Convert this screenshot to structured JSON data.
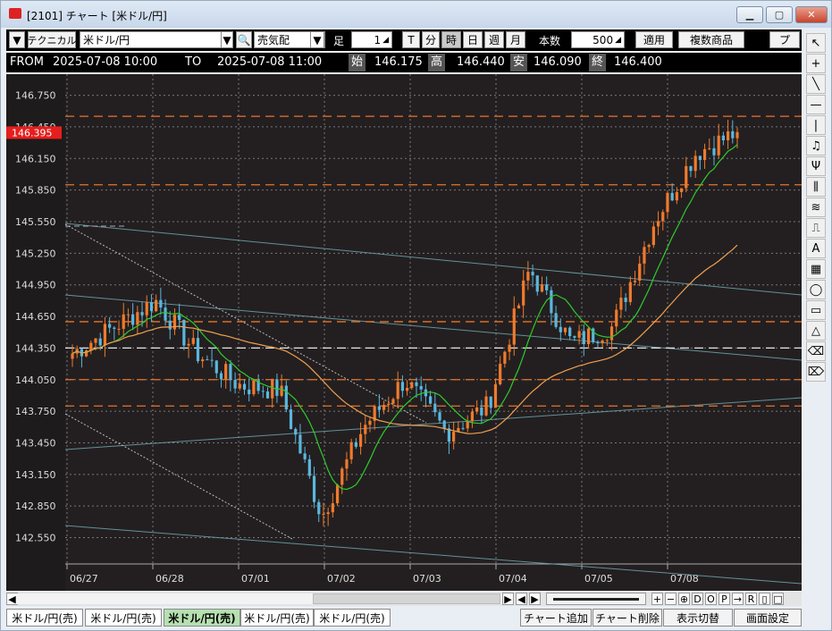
{
  "window": {
    "title": "[2101] チャート [米ドル/円]",
    "minimize_icon": "minimize-icon",
    "maximize_icon": "maximize-icon",
    "close_icon": "close-icon"
  },
  "toolbar": {
    "mode": "テクニカル",
    "symbol": "米ドル/円",
    "side": "売気配",
    "ashi_label": "足",
    "ashi_value": "1",
    "periods": [
      "T",
      "分",
      "時",
      "日",
      "週",
      "月"
    ],
    "active_period": "時",
    "count_label": "本数",
    "count_value": "500",
    "apply_label": "適用",
    "multi_label": "複数商品",
    "more_label": "プ"
  },
  "ohlc_bar": {
    "from_label": "FROM",
    "from_value": "2025-07-08  10:00",
    "to_label": "TO",
    "to_value": "2025-07-08  11:00",
    "open_label": "始",
    "open_value": "146.175",
    "high_label": "高",
    "high_value": "146.440",
    "low_label": "安",
    "low_value": "146.090",
    "close_label": "終",
    "close_value": "146.400"
  },
  "chart_data": {
    "type": "candlestick",
    "current_price_tag": "146.395",
    "y_ticks": [
      "146.750",
      "146.450",
      "146.150",
      "145.850",
      "145.550",
      "145.250",
      "144.950",
      "144.650",
      "144.350",
      "144.050",
      "143.750",
      "143.450",
      "143.150",
      "142.850",
      "142.550"
    ],
    "ylim": [
      142.3,
      146.95
    ],
    "x_ticks": [
      "06/27",
      "06/28",
      "07/01",
      "07/02",
      "07/03",
      "07/04",
      "07/05",
      "07/08"
    ],
    "horizontal_levels": [
      146.55,
      145.9,
      144.6,
      144.35,
      144.05,
      143.8
    ],
    "level_colors": {
      "orange": "#e8742a",
      "white": "#e6e6e6"
    },
    "ma_colors": {
      "short": "#2ecc2e",
      "long": "#f0a050",
      "trend": "#6fa5b0"
    },
    "candle_colors": {
      "up": "#f07a2c",
      "down": "#5ab7de"
    },
    "key_prices": [
      {
        "time": "06/26",
        "price": 144.3
      },
      {
        "time": "06/27",
        "price": 144.55
      },
      {
        "time": "06/28",
        "price": 144.8
      },
      {
        "time": "06/29",
        "price": 144.3
      },
      {
        "time": "06/30",
        "price": 144.0
      },
      {
        "time": "07/01",
        "price": 143.95
      },
      {
        "time": "07/01 late",
        "price": 142.75
      },
      {
        "time": "07/02",
        "price": 143.6
      },
      {
        "time": "07/03",
        "price": 144.05
      },
      {
        "time": "07/03 late",
        "price": 143.55
      },
      {
        "time": "07/04 pre",
        "price": 143.8
      },
      {
        "time": "07/04",
        "price": 145.1
      },
      {
        "time": "07/04 late",
        "price": 144.4
      },
      {
        "time": "07/05",
        "price": 144.55
      },
      {
        "time": "07/07",
        "price": 145.55
      },
      {
        "time": "07/08",
        "price": 146.2
      },
      {
        "time": "07/08 last",
        "price": 146.4
      }
    ]
  },
  "right_tools": [
    "cursor-icon",
    "crosshair-icon",
    "trendline-icon",
    "hline-icon",
    "vline-icon",
    "bell-icon",
    "fork-icon",
    "fib-icon",
    "gann-icon",
    "step-icon",
    "text-icon",
    "grid-icon",
    "ellipse-icon",
    "rect-icon",
    "triangle-icon",
    "eraser-icon",
    "eraser-all-icon"
  ],
  "scroll": {
    "left_arrow": "◀",
    "right_arrow": "▶",
    "controls": [
      "+",
      "−",
      "⊕",
      "D",
      "O",
      "P",
      "→",
      "R",
      "▯",
      "□"
    ]
  },
  "tabs": [
    "米ドル/円(売)",
    "米ドル/円(売)",
    "米ドル/円(売)",
    "米ドル/円(売)",
    "米ドル/円(売)"
  ],
  "active_tab_index": 2,
  "bottom_buttons": [
    "チャート追加",
    "チャート削除",
    "表示切替",
    "画面設定"
  ]
}
